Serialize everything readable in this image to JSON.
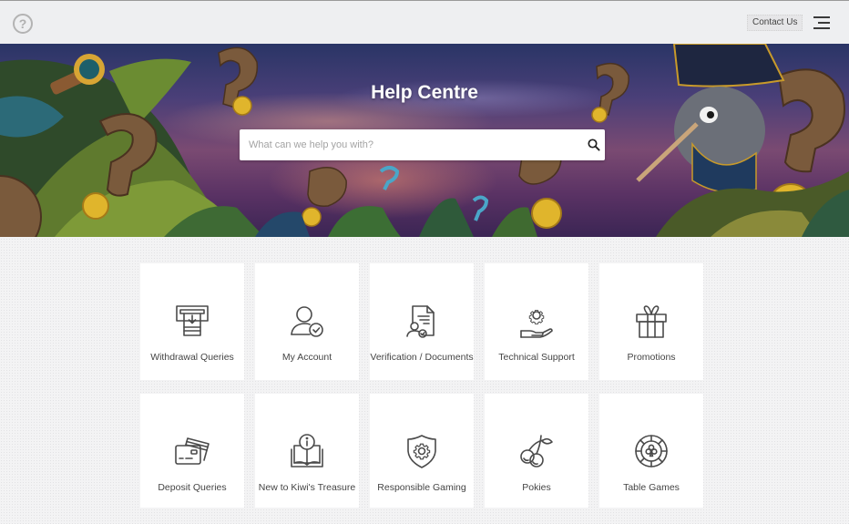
{
  "header": {
    "help_icon": "question-circle-icon",
    "help_glyph": "?",
    "contact_label": "Contact Us",
    "menu_icon": "hamburger-menu-icon"
  },
  "hero": {
    "title": "Help Centre",
    "search": {
      "placeholder": "What can we help you with?",
      "value": "",
      "icon": "search-icon"
    }
  },
  "categories": [
    {
      "label": "Withdrawal Queries",
      "icon": "atm-withdrawal-icon"
    },
    {
      "label": "My Account",
      "icon": "user-check-icon"
    },
    {
      "label": "Verification / Documents",
      "icon": "document-verification-icon"
    },
    {
      "label": "Technical Support",
      "icon": "gear-hand-icon"
    },
    {
      "label": "Promotions",
      "icon": "gift-icon"
    },
    {
      "label": "Deposit Queries",
      "icon": "credit-cards-icon"
    },
    {
      "label": "New to Kiwi's Treasure",
      "icon": "book-info-icon"
    },
    {
      "label": "Responsible Gaming",
      "icon": "shield-gear-icon"
    },
    {
      "label": "Pokies",
      "icon": "cherries-icon"
    },
    {
      "label": "Table Games",
      "icon": "casino-chip-icon"
    }
  ]
}
